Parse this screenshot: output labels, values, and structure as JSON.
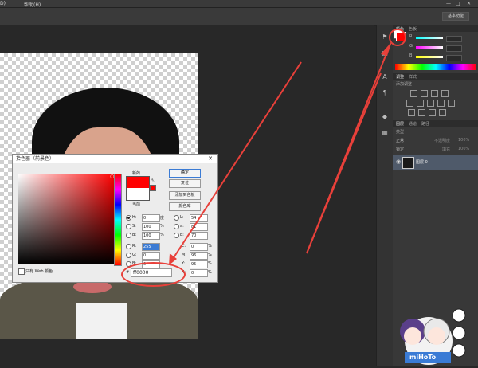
{
  "menubar": {
    "item1": "D)",
    "item2": "帮助(H)"
  },
  "options_bar": {
    "workspace_label": "基本功能"
  },
  "color_panel": {
    "tabs": [
      "颜色",
      "色板"
    ],
    "sliders": [
      {
        "label": "R",
        "value": ""
      },
      {
        "label": "G",
        "value": ""
      },
      {
        "label": "B",
        "value": ""
      }
    ],
    "fg_color": "#ff0000"
  },
  "adjust_panel": {
    "tabs": [
      "调整",
      "样式"
    ],
    "subtitle": "添加调整"
  },
  "layers_panel": {
    "tabs": [
      "图层",
      "通道",
      "路径"
    ],
    "kind_label": "类型",
    "blend_mode": "正常",
    "opacity_label": "不透明度",
    "opacity_value": "100%",
    "lock_label": "锁定",
    "fill_label": "填充",
    "fill_value": "100%",
    "layer_name": "图层 0"
  },
  "dialog": {
    "title": "拾色器（前景色）",
    "new_label": "新的",
    "current_label": "当前",
    "buttons": {
      "ok": "确定",
      "reset": "复位",
      "add_swatch": "添加到色板",
      "color_library": "颜色库"
    },
    "hsb": [
      {
        "label": "H:",
        "value": "0",
        "unit": "度"
      },
      {
        "label": "S:",
        "value": "100",
        "unit": "%"
      },
      {
        "label": "B:",
        "value": "100",
        "unit": "%"
      }
    ],
    "rgb": [
      {
        "label": "R:",
        "value": "255"
      },
      {
        "label": "G:",
        "value": "0"
      },
      {
        "label": "B:",
        "value": "0"
      }
    ],
    "lab": [
      {
        "label": "L:",
        "value": "54"
      },
      {
        "label": "a:",
        "value": "81"
      },
      {
        "label": "b:",
        "value": "70"
      }
    ],
    "cmyk": [
      {
        "label": "C:",
        "value": "0",
        "unit": "%"
      },
      {
        "label": "M:",
        "value": "96",
        "unit": "%"
      },
      {
        "label": "Y:",
        "value": "95",
        "unit": "%"
      },
      {
        "label": "K:",
        "value": "0",
        "unit": "%"
      }
    ],
    "web_only_label": "只有 Web 颜色",
    "hex_prefix": "#",
    "hex_value": "ff0000"
  },
  "watermark": "miHoTo",
  "accent_colors": {
    "annotation": "#e8403a",
    "picked": "#ff0000"
  }
}
